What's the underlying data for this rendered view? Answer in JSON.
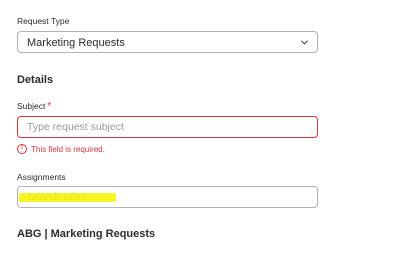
{
  "request_type": {
    "label": "Request Type",
    "selected_value": "Marketing Requests"
  },
  "details": {
    "heading": "Details",
    "subject": {
      "label": "Subject",
      "required_marker": "*",
      "placeholder": "Type request subject",
      "value": "",
      "error_icon_glyph": "!",
      "error_message": "This field is required."
    },
    "assignments": {
      "label": "Assignments",
      "placeholder": "Search roles",
      "value": ""
    }
  },
  "section_heading": "ABG | Marketing Requests",
  "colors": {
    "error": "#d7373f",
    "border": "#b3b3b3",
    "highlight": "#f5f500"
  },
  "icons": {
    "dropdown": "chevron-down-icon",
    "error": "alert-circle-icon"
  }
}
